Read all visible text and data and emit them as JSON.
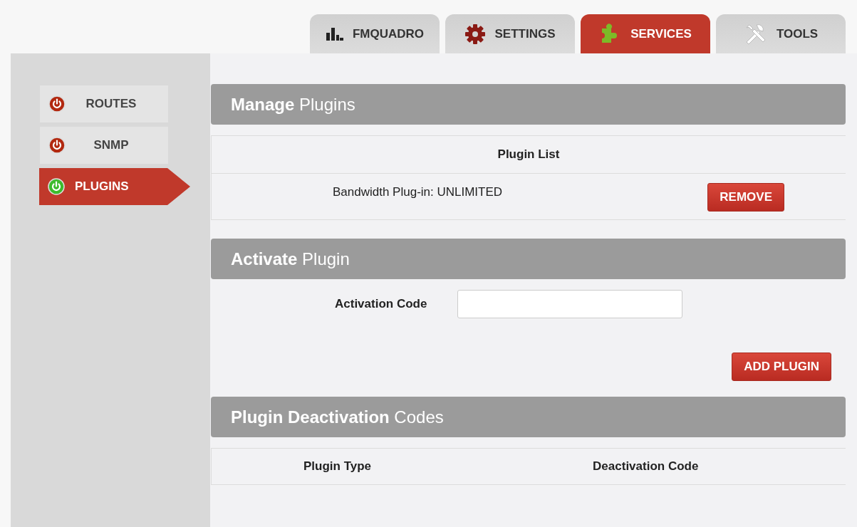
{
  "tabs": [
    {
      "label": "FMQUADRO",
      "selected": false
    },
    {
      "label": "SETTINGS",
      "selected": false
    },
    {
      "label": "SERVICES",
      "selected": true
    },
    {
      "label": "TOOLS",
      "selected": false
    }
  ],
  "sidebar": {
    "items": [
      {
        "label": "ROUTES",
        "selected": false
      },
      {
        "label": "SNMP",
        "selected": false
      },
      {
        "label": "PLUGINS",
        "selected": true
      }
    ]
  },
  "manage_plugins": {
    "title": "**Manage** Plugins",
    "list_heading": "Plugin List",
    "rows": [
      {
        "name": "Bandwidth Plug-in: UNLIMITED",
        "button": "REMOVE"
      }
    ]
  },
  "activate_plugin": {
    "title": "**Activate** Plugin",
    "field_label": "Activation Code",
    "button": "ADD PLUGIN"
  },
  "deactivation_codes": {
    "title": "**Plugin Deactivation** Codes",
    "columns": [
      "Plugin Type",
      "Deactivation Code"
    ]
  }
}
